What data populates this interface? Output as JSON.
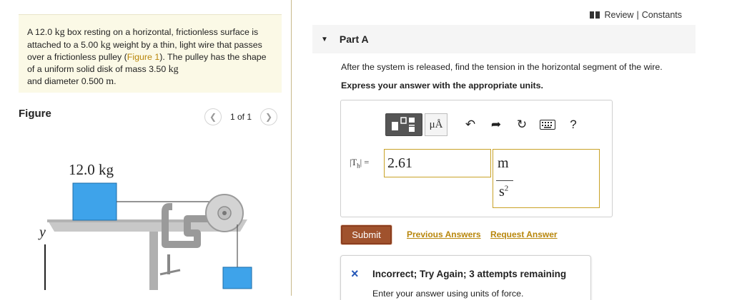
{
  "problem": {
    "t1": "A 12.0 ",
    "m1": "kg",
    "t2": " box resting on a horizontal, frictionless surface is attached to a 5.00 ",
    "m2": "kg",
    "t3": " weight by a thin, light wire that passes over a frictionless pulley (",
    "figure_link": "Figure 1",
    "t4": "). The pulley has the shape of a uniform solid disk of mass 3.50 ",
    "m3": "kg",
    "t5": " and diameter 0.500 ",
    "m4": "m",
    "t6": "."
  },
  "figure": {
    "title": "Figure",
    "pager": "1 of 1",
    "prev_icon": "chevron-left-icon",
    "next_icon": "chevron-right-icon",
    "box_label": "12.0 kg",
    "y_label": "y"
  },
  "topbar": {
    "review": "Review",
    "sep": "|",
    "constants": "Constants"
  },
  "part": {
    "title": "Part A",
    "question": "After the system is released, find the tension in the horizontal segment of the wire.",
    "instructions": "Express your answer with the appropriate units."
  },
  "toolbar": {
    "units_label": "μÅ",
    "undo_icon": "undo-icon",
    "redo_icon": "redo-icon",
    "reset_icon": "reset-icon",
    "keyboard_icon": "keyboard-icon",
    "help": "?"
  },
  "answer": {
    "var_label": "|T",
    "var_sub": "h",
    "var_suffix": "| =",
    "value": "2.61",
    "unit_num": "m",
    "unit_den": "s",
    "unit_exp": "2"
  },
  "actions": {
    "submit": "Submit",
    "previous": "Previous Answers",
    "request": "Request Answer"
  },
  "feedback": {
    "icon": "×",
    "message": "Incorrect; Try Again; 3 attempts remaining",
    "hint": "Enter your answer using units of force."
  },
  "colors": {
    "accent_link": "#b8860b",
    "submit": "#a0522d",
    "box": "#3ea3ea",
    "problem_bg": "#fbf9e6",
    "error_x": "#2558b8"
  }
}
